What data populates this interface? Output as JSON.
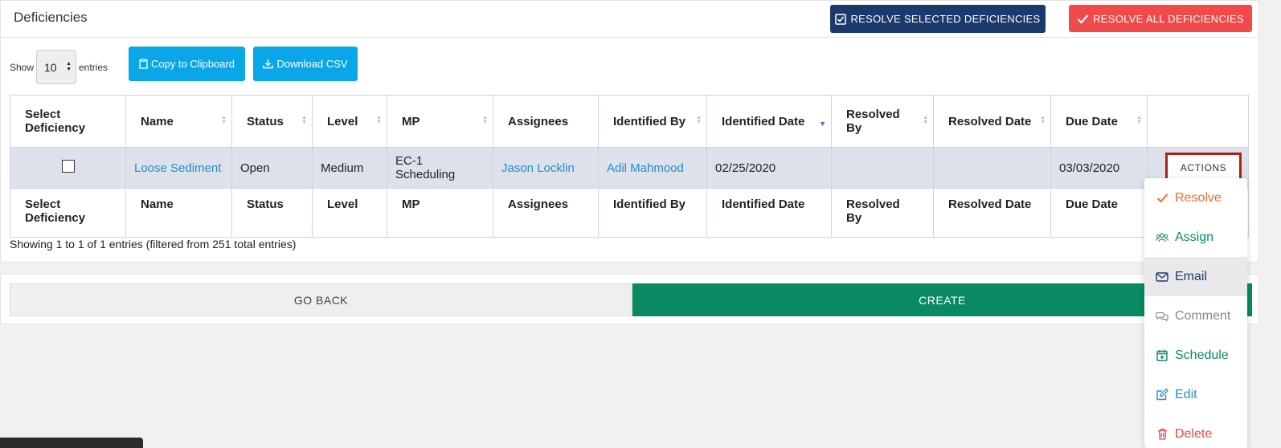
{
  "header": {
    "title": "Deficiencies",
    "resolve_selected_label": "RESOLVE SELECTED DEFICIENCIES",
    "resolve_all_label": "RESOLVE ALL DEFICIENCIES"
  },
  "controls": {
    "show_label": "Show",
    "entries_value": "10",
    "entries_label": "entries",
    "copy_label": "Copy to Clipboard",
    "csv_label": "Download CSV"
  },
  "table": {
    "columns": [
      "Select Deficiency",
      "Name",
      "Status",
      "Level",
      "MP",
      "Assignees",
      "Identified By",
      "Identified Date",
      "Resolved By",
      "Resolved Date",
      "Due Date"
    ],
    "rows": [
      {
        "name": "Loose Sediment",
        "status": "Open",
        "level": "Medium",
        "mp": "EC-1 Scheduling",
        "assignees": "Jason Locklin",
        "identified_by": "Adil Mahmood",
        "identified_date": "02/25/2020",
        "resolved_by": "",
        "resolved_date": "",
        "due_date": "03/03/2020",
        "actions_label": "ACTIONS"
      }
    ],
    "info": "Showing 1 to 1 of 1 entries (filtered from 251 total entries)"
  },
  "footer": {
    "go_back_label": "GO BACK",
    "create_label": "CREATE"
  },
  "actions_menu": [
    {
      "label": "Resolve",
      "icon": "check-icon",
      "color": "#f26b2a"
    },
    {
      "label": "Assign",
      "icon": "users-icon",
      "color": "#0a8a62"
    },
    {
      "label": "Email",
      "icon": "envelope-icon",
      "color": "#1b3a6b"
    },
    {
      "label": "Comment",
      "icon": "comments-icon",
      "color": "#888888"
    },
    {
      "label": "Schedule",
      "icon": "calendar-plus-icon",
      "color": "#0a8a62"
    },
    {
      "label": "Edit",
      "icon": "edit-icon",
      "color": "#1c8fd6"
    },
    {
      "label": "Delete",
      "icon": "trash-icon",
      "color": "#e04848"
    }
  ]
}
